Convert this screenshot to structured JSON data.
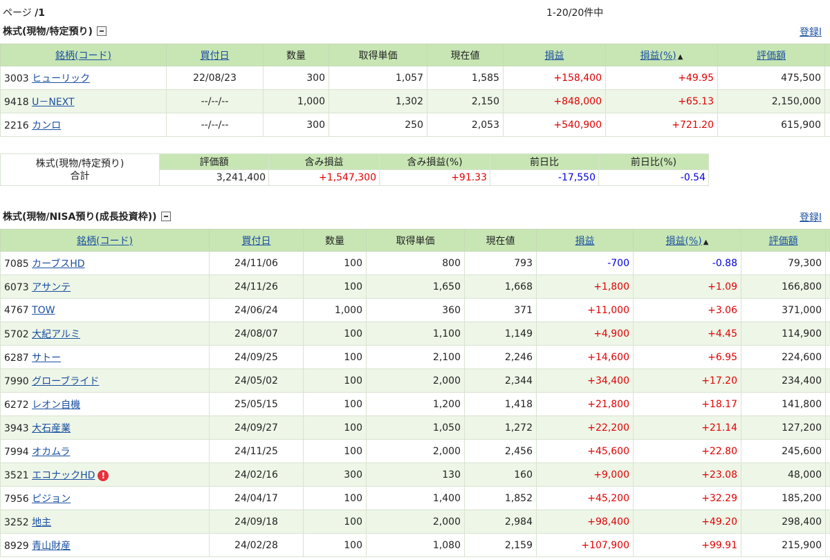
{
  "pager": {
    "prefix": "ページ ",
    "page": "/1"
  },
  "count": "1-20/20件中",
  "register_label": "登録l",
  "section1": {
    "title": "株式(現物/特定預り)",
    "headers": [
      "銘柄(コード)",
      "買付日",
      "数量",
      "取得単価",
      "現在値",
      "損益",
      "損益(%)",
      "評価額"
    ],
    "rows": [
      {
        "code": "3003",
        "name": "ヒューリック",
        "date": "22/08/23",
        "qty": "300",
        "cost": "1,057",
        "price": "1,585",
        "pl": "+158,400",
        "plpct": "+49.95",
        "value": "475,500"
      },
      {
        "code": "9418",
        "name": "U－NEXT",
        "date": "--/--/--",
        "qty": "1,000",
        "cost": "1,302",
        "price": "2,150",
        "pl": "+848,000",
        "plpct": "+65.13",
        "value": "2,150,000"
      },
      {
        "code": "2216",
        "name": "カンロ",
        "date": "--/--/--",
        "qty": "300",
        "cost": "250",
        "price": "2,053",
        "pl": "+540,900",
        "plpct": "+721.20",
        "value": "615,900"
      }
    ]
  },
  "summary": {
    "label_line1": "株式(現物/特定預り)",
    "label_line2": "合計",
    "headers": [
      "評価額",
      "含み損益",
      "含み損益(%)",
      "前日比",
      "前日比(%)"
    ],
    "values": [
      "3,241,400",
      "+1,547,300",
      "+91.33",
      "-17,550",
      "-0.54"
    ]
  },
  "section2": {
    "title": "株式(現物/NISA預り(成長投資枠))",
    "headers": [
      "銘柄(コード)",
      "買付日",
      "数量",
      "取得単価",
      "現在値",
      "損益",
      "損益(%)",
      "評価額"
    ],
    "rows": [
      {
        "code": "7085",
        "name": "カーブスHD",
        "date": "24/11/06",
        "qty": "100",
        "cost": "800",
        "price": "793",
        "pl": "-700",
        "plpct": "-0.88",
        "value": "79,300"
      },
      {
        "code": "6073",
        "name": "アサンテ",
        "date": "24/11/26",
        "qty": "100",
        "cost": "1,650",
        "price": "1,668",
        "pl": "+1,800",
        "plpct": "+1.09",
        "value": "166,800"
      },
      {
        "code": "4767",
        "name": "TOW",
        "date": "24/06/24",
        "qty": "1,000",
        "cost": "360",
        "price": "371",
        "pl": "+11,000",
        "plpct": "+3.06",
        "value": "371,000"
      },
      {
        "code": "5702",
        "name": "大紀アルミ",
        "date": "24/08/07",
        "qty": "100",
        "cost": "1,100",
        "price": "1,149",
        "pl": "+4,900",
        "plpct": "+4.45",
        "value": "114,900"
      },
      {
        "code": "6287",
        "name": "サトー",
        "date": "24/09/25",
        "qty": "100",
        "cost": "2,100",
        "price": "2,246",
        "pl": "+14,600",
        "plpct": "+6.95",
        "value": "224,600"
      },
      {
        "code": "7990",
        "name": "グローブライド",
        "date": "24/05/02",
        "qty": "100",
        "cost": "2,000",
        "price": "2,344",
        "pl": "+34,400",
        "plpct": "+17.20",
        "value": "234,400"
      },
      {
        "code": "6272",
        "name": "レオン自機",
        "date": "25/05/15",
        "qty": "100",
        "cost": "1,200",
        "price": "1,418",
        "pl": "+21,800",
        "plpct": "+18.17",
        "value": "141,800"
      },
      {
        "code": "3943",
        "name": "大石産業",
        "date": "24/09/27",
        "qty": "100",
        "cost": "1,050",
        "price": "1,272",
        "pl": "+22,200",
        "plpct": "+21.14",
        "value": "127,200"
      },
      {
        "code": "7994",
        "name": "オカムラ",
        "date": "24/11/25",
        "qty": "100",
        "cost": "2,000",
        "price": "2,456",
        "pl": "+45,600",
        "plpct": "+22.80",
        "value": "245,600"
      },
      {
        "code": "3521",
        "name": "エコナックHD",
        "date": "24/02/16",
        "qty": "300",
        "cost": "130",
        "price": "160",
        "pl": "+9,000",
        "plpct": "+23.08",
        "value": "48,000",
        "warning": "!"
      },
      {
        "code": "7956",
        "name": "ピジョン",
        "date": "24/04/17",
        "qty": "100",
        "cost": "1,400",
        "price": "1,852",
        "pl": "+45,200",
        "plpct": "+32.29",
        "value": "185,200"
      },
      {
        "code": "3252",
        "name": "地主",
        "date": "24/09/18",
        "qty": "100",
        "cost": "2,000",
        "price": "2,984",
        "pl": "+98,400",
        "plpct": "+49.20",
        "value": "298,400"
      },
      {
        "code": "8929",
        "name": "青山財産",
        "date": "24/02/28",
        "qty": "100",
        "cost": "1,080",
        "price": "2,159",
        "pl": "+107,900",
        "plpct": "+99.91",
        "value": "215,900"
      }
    ]
  },
  "colors": {
    "header_bg": "#c8e6b4",
    "alt_row": "#eef6e8",
    "positive": "#e00000",
    "negative": "#0000e0",
    "link": "#1a4fa0"
  },
  "icons": {
    "collapse": "minus-box-icon",
    "sort": "sort-triangle-icon",
    "warning": "warning-icon"
  }
}
